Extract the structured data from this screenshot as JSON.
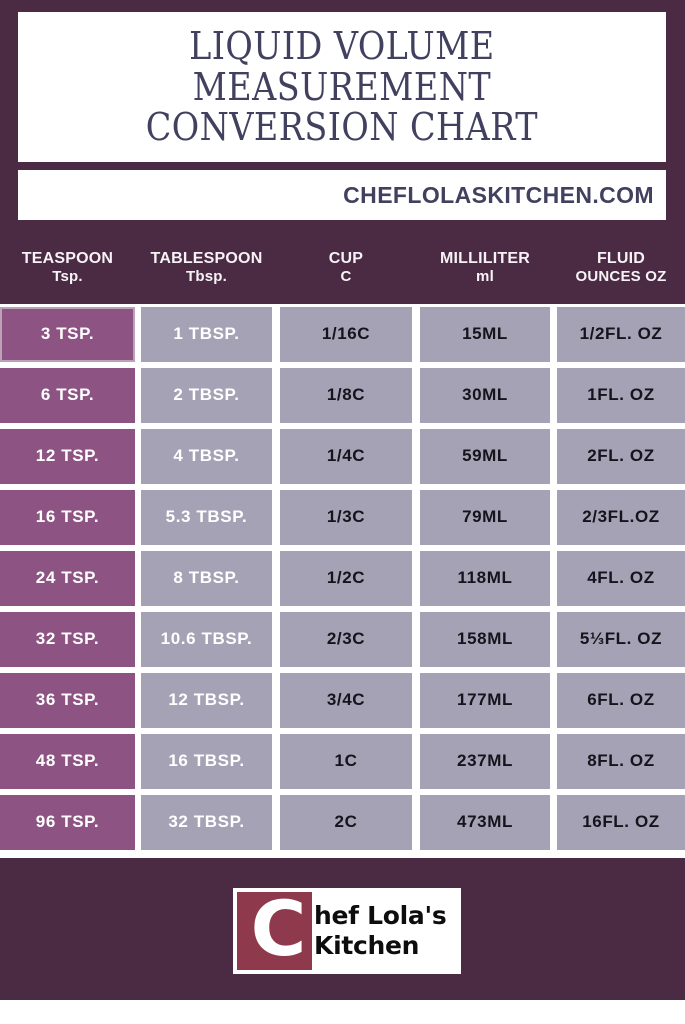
{
  "title": {
    "text": "LIQUID VOLUME\nMEASUREMENT\nCONVERSION CHART"
  },
  "website": {
    "url": "CHEFLOLASKITCHEN.COM"
  },
  "colors": {
    "frame_purple": "#4a2b43",
    "teaspoon_cell": "#8d5382",
    "other_cell": "#a5a2b5",
    "title_text": "#41415f",
    "logo_mark": "#8e3a4c"
  },
  "table": {
    "headers": [
      {
        "line1": "TEASPOON",
        "line2": "Tsp."
      },
      {
        "line1": "TABLESPOON",
        "line2": "Tbsp."
      },
      {
        "line1": "CUP",
        "line2": "C"
      },
      {
        "line1": "MILLILITER",
        "line2": "ml"
      },
      {
        "line1": "FLUID",
        "line2": "OUNCES OZ"
      }
    ],
    "rows": [
      {
        "teaspoon": "3 TSP.",
        "tablespoon": "1 TBSP.",
        "cup": "1/16C",
        "milliliter": "15ML",
        "fluid_ounces": "1/2FL. OZ"
      },
      {
        "teaspoon": "6 TSP.",
        "tablespoon": "2 TBSP.",
        "cup": "1/8C",
        "milliliter": "30ML",
        "fluid_ounces": "1FL. OZ"
      },
      {
        "teaspoon": "12 TSP.",
        "tablespoon": "4 TBSP.",
        "cup": "1/4C",
        "milliliter": "59ML",
        "fluid_ounces": "2FL. OZ"
      },
      {
        "teaspoon": "16 TSP.",
        "tablespoon": "5.3 TBSP.",
        "cup": "1/3C",
        "milliliter": "79ML",
        "fluid_ounces": "2/3FL.OZ"
      },
      {
        "teaspoon": "24 TSP.",
        "tablespoon": "8 TBSP.",
        "cup": "1/2C",
        "milliliter": "118ML",
        "fluid_ounces": "4FL. OZ"
      },
      {
        "teaspoon": "32 TSP.",
        "tablespoon": "10.6 TBSP.",
        "cup": "2/3C",
        "milliliter": "158ML",
        "fluid_ounces": "5⅓FL. OZ"
      },
      {
        "teaspoon": "36 TSP.",
        "tablespoon": "12 TBSP.",
        "cup": "3/4C",
        "milliliter": "177ML",
        "fluid_ounces": "6FL. OZ"
      },
      {
        "teaspoon": "48 TSP.",
        "tablespoon": "16 TBSP.",
        "cup": "1C",
        "milliliter": "237ML",
        "fluid_ounces": "8FL. OZ"
      },
      {
        "teaspoon": "96 TSP.",
        "tablespoon": "32 TBSP.",
        "cup": "2C",
        "milliliter": "473ML",
        "fluid_ounces": "16FL. OZ"
      }
    ]
  },
  "logo": {
    "mark_letter": "C",
    "line1": "hef Lola's",
    "line2": "Kitchen"
  }
}
